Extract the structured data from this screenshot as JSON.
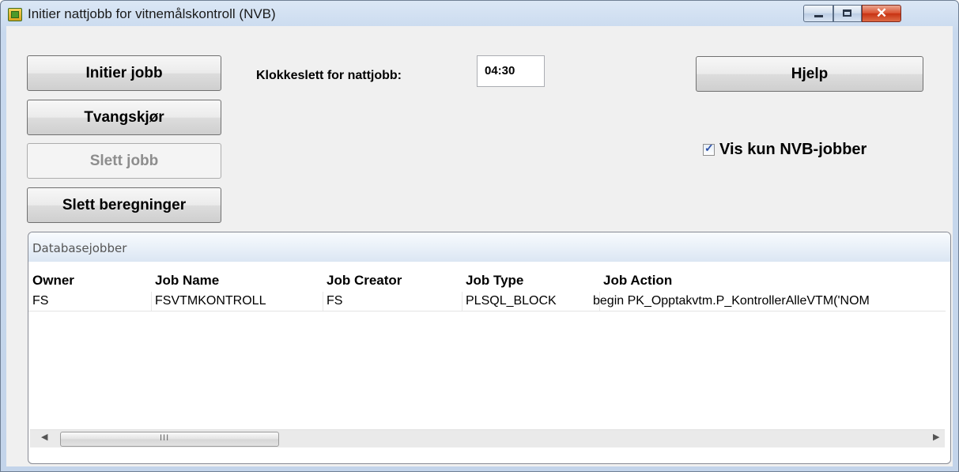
{
  "window": {
    "title": "Initier nattjobb for vitnemålskontroll (NVB)",
    "controls": {
      "minimize": "minimize",
      "maximize": "maximize",
      "close": "✕"
    }
  },
  "toolbar": {
    "initier": "Initier jobb",
    "tvangskjor": "Tvangskjør",
    "slett_jobb": "Slett jobb",
    "slett_beregninger": "Slett beregninger",
    "hjelp": "Hjelp",
    "time_label": "Klokkeslett for nattjobb:",
    "time_value": "04:30",
    "vis_kun_label": "Vis kun NVB-jobber",
    "vis_kun_checked": true
  },
  "group": {
    "title": "Databasejobber",
    "columns": [
      "Owner",
      "Job Name",
      "Job Creator",
      "Job Type",
      "Job Action"
    ],
    "rows": [
      [
        "FS",
        "FSVTMKONTROLL",
        "FS",
        "PLSQL_BLOCK",
        "begin PK_Opptakvtm.P_KontrollerAlleVTM('NOM"
      ]
    ]
  },
  "scrollbar": {
    "left": "◀",
    "right": "▶",
    "grip": "III"
  },
  "colors": {
    "accent": "#2a4fa8",
    "window_frame": "#c3d4ea",
    "client_bg": "#f0f0f0"
  }
}
